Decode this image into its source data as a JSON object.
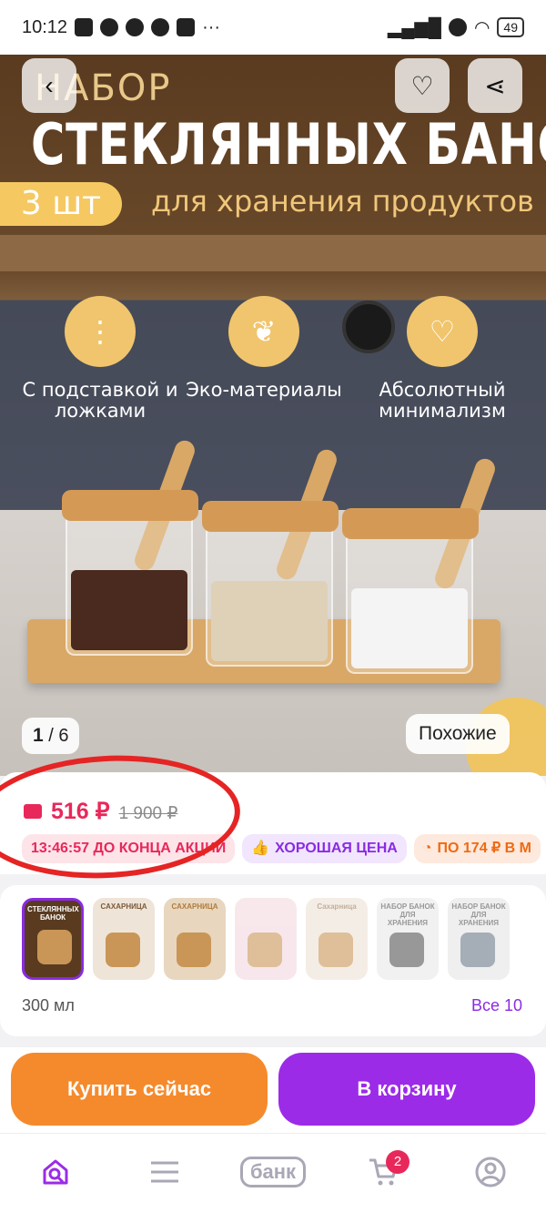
{
  "status_bar": {
    "time": "10:12",
    "more": "···",
    "battery": "49"
  },
  "hero": {
    "title_small": "НАБОР",
    "title_big": "СТЕКЛЯННЫХ БАНОК",
    "badge": "3 шт",
    "subtitle": "для хранения продуктов",
    "features": [
      {
        "label": "С подставкой и ложками"
      },
      {
        "label": "Эко-материалы"
      },
      {
        "label": "Абсолютный минимализм"
      }
    ],
    "page_index": "1",
    "page_total": "6",
    "similar_label": "Похожие"
  },
  "price": {
    "current": "516 ₽",
    "old": "1 900 ₽",
    "chips": [
      {
        "text": "13:46:57 ДО КОНЦА АКЦИИ"
      },
      {
        "text": "ХОРОШАЯ ЦЕНА"
      },
      {
        "text": "ПО 174 ₽ В М"
      }
    ]
  },
  "variants": {
    "thumbs": [
      {
        "caption": "СТЕКЛЯННЫХ БАНОК"
      },
      {
        "caption": "САХАРНИЦА"
      },
      {
        "caption": "САХАРНИЦА"
      },
      {
        "caption": ""
      },
      {
        "caption": "Сахарница"
      },
      {
        "caption": "НАБОР БАНОК ДЛЯ ХРАНЕНИЯ"
      },
      {
        "caption": "НАБОР БАНОК ДЛЯ ХРАНЕНИЯ"
      }
    ],
    "selected_label": "300 мл",
    "all_label": "Все 10"
  },
  "actions": {
    "buy_now": "Купить сейчас",
    "add_to_cart": "В корзину"
  },
  "nav": {
    "bank_label": "банк",
    "cart_count": "2"
  }
}
